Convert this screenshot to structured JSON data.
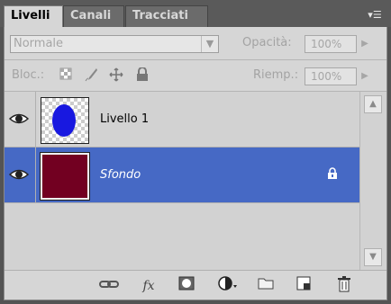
{
  "tabs": [
    {
      "label": "Livelli"
    },
    {
      "label": "Canali"
    },
    {
      "label": "Tracciati"
    }
  ],
  "panel_menu_icon": "panel-menu-icon",
  "blend_mode": {
    "value": "Normale"
  },
  "opacity": {
    "label": "Opacità:",
    "value": "100%"
  },
  "lock": {
    "label": "Bloc.:",
    "icons": [
      "lock-transparent-icon",
      "lock-paint-icon",
      "lock-move-icon",
      "lock-all-icon"
    ]
  },
  "fill": {
    "label": "Riemp.:",
    "value": "100%"
  },
  "layers": [
    {
      "name": "Livello 1",
      "visible": true,
      "selected": false,
      "thumbnail_color": "#1818e0"
    },
    {
      "name": "Sfondo",
      "visible": true,
      "selected": true,
      "locked": true,
      "thumbnail_color": "#720021"
    }
  ],
  "footer_buttons": [
    "link-icon",
    "fx-icon",
    "mask-icon",
    "adjustment-icon",
    "folder-icon",
    "new-layer-icon",
    "trash-icon"
  ],
  "colors": {
    "selection": "#4669c5",
    "panel": "#d6d6d6"
  }
}
